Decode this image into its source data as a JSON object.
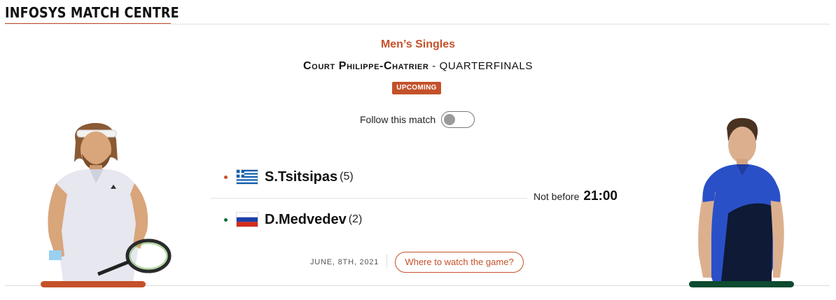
{
  "header": {
    "title": "INFOSYS MATCH CENTRE"
  },
  "match": {
    "category": "Men’s Singles",
    "court": "Court Philippe-Chatrier",
    "separator": "-",
    "round": "Quarterfinals",
    "status": "UPCOMING",
    "follow_label": "Follow this match",
    "follow_enabled": false,
    "time_label": "Not before",
    "time": "21:00",
    "date": "June, 8th, 2021",
    "watch_label": "Where to watch the game?"
  },
  "players": [
    {
      "name": "S.Tsitsipas",
      "seed": "(5)",
      "country": "Greece",
      "dot_color": "#c4512a",
      "accent": "#c4512a"
    },
    {
      "name": "D.Medvedev",
      "seed": "(2)",
      "country": "Russia",
      "dot_color": "#0d6b3b",
      "accent": "#0d4a2f"
    }
  ],
  "icons": {
    "toggle": "toggle-switch",
    "flag_greece": "greece-flag-icon",
    "flag_russia": "russia-flag-icon"
  }
}
